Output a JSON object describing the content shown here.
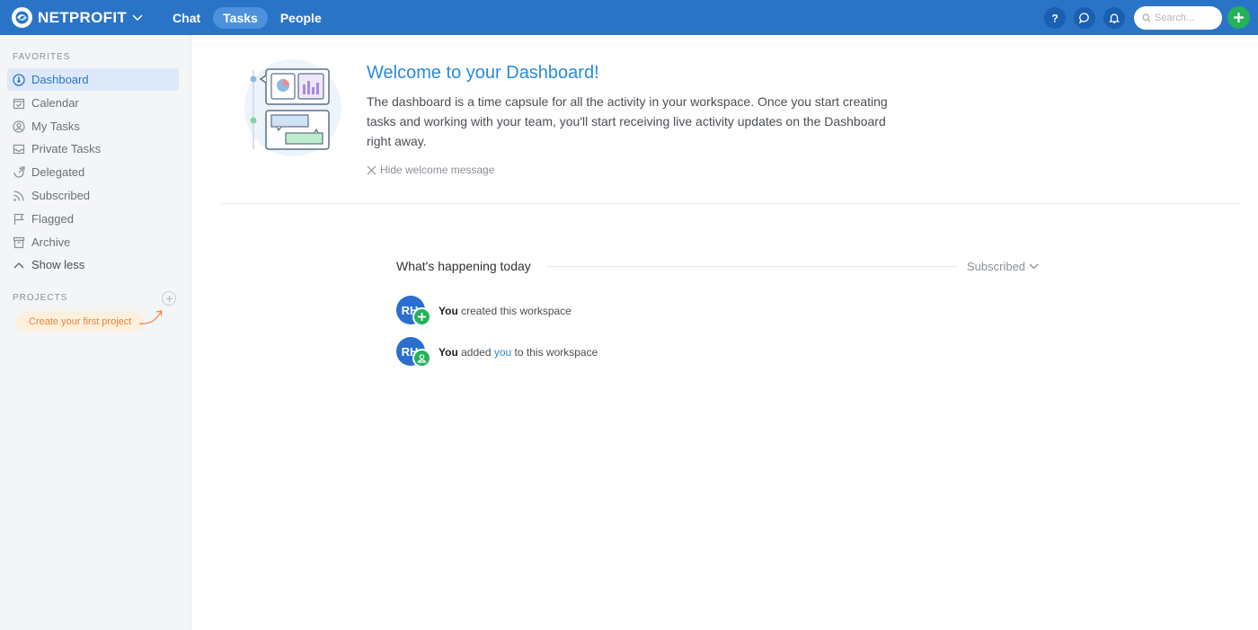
{
  "app": {
    "brand": "NETPROFIT",
    "nav": [
      {
        "label": "Chat",
        "active": false
      },
      {
        "label": "Tasks",
        "active": true
      },
      {
        "label": "People",
        "active": false
      }
    ],
    "search_placeholder": "Search...",
    "accent_color": "#2a74c8",
    "add_color": "#22b35a"
  },
  "sidebar": {
    "favorites_label": "FAVORITES",
    "items": [
      {
        "label": "Dashboard",
        "icon": "dashboard-icon",
        "active": true
      },
      {
        "label": "Calendar",
        "icon": "calendar-icon"
      },
      {
        "label": "My Tasks",
        "icon": "user-icon"
      },
      {
        "label": "Private Tasks",
        "icon": "inbox-icon"
      },
      {
        "label": "Delegated",
        "icon": "delegate-icon"
      },
      {
        "label": "Subscribed",
        "icon": "rss-icon"
      },
      {
        "label": "Flagged",
        "icon": "flag-icon"
      },
      {
        "label": "Archive",
        "icon": "archive-icon"
      },
      {
        "label": "Show less",
        "icon": "chevron-up-icon"
      }
    ],
    "projects_label": "PROJECTS",
    "create_project": "Create your first project"
  },
  "welcome": {
    "title": "Welcome to your Dashboard!",
    "body": "The dashboard is a time capsule for all the activity in your workspace. Once you start creating tasks and working with your team, you'll start receiving live activity updates on the Dashboard right away.",
    "hide": "Hide welcome message"
  },
  "feed": {
    "title": "What's happening today",
    "filter": "Subscribed",
    "activities": [
      {
        "avatar": "RH",
        "actor": "You",
        "text": "created this workspace",
        "badge": "plus-icon"
      },
      {
        "avatar": "RH",
        "actor": "You",
        "pre": "added",
        "link": "you",
        "post": "to this workspace",
        "badge": "user-icon"
      }
    ]
  }
}
